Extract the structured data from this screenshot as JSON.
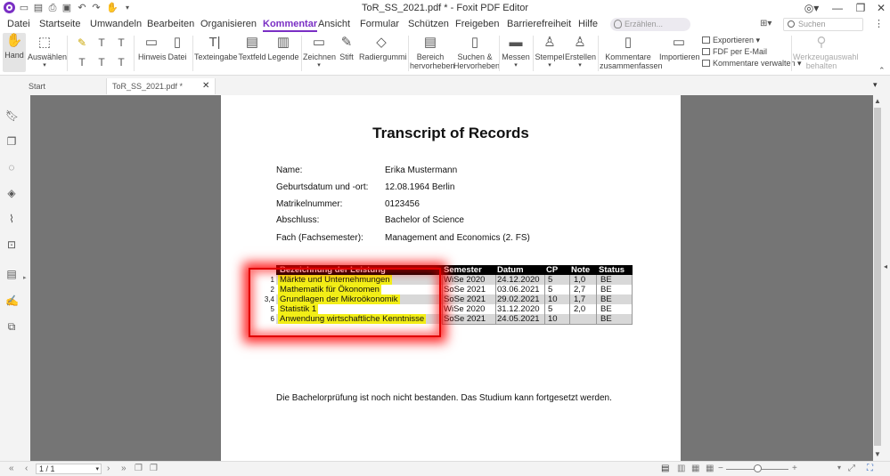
{
  "window": {
    "title": "ToR_SS_2021.pdf * - Foxit PDF Editor",
    "controls": [
      "minimize-icon",
      "restore-icon",
      "close-icon"
    ]
  },
  "menu": {
    "tabs": [
      "Datei",
      "Startseite",
      "Umwandeln",
      "Bearbeiten",
      "Organisieren",
      "Kommentar",
      "Ansicht",
      "Formular",
      "Schützen",
      "Freigeben",
      "Barrierefreiheit",
      "Hilfe"
    ],
    "active_tab": "Kommentar",
    "tell_me_placeholder": "Erzählen...",
    "search_placeholder": "Suchen"
  },
  "ribbon": {
    "hand": "Hand",
    "select": "Auswählen",
    "note": "Hinweis",
    "file": "Datei",
    "typewriter": "Texteingabe",
    "textbox": "Textfeld",
    "callout": "Legende",
    "drawing": "Zeichnen",
    "pencil": "Stift",
    "eraser": "Radiergummi",
    "area_highlight": [
      "Bereich",
      "hervorheben"
    ],
    "search_highlight": [
      "Suchen &",
      "Hervorheben"
    ],
    "measure": "Messen",
    "stamp": "Stempel",
    "create": "Erstellen",
    "summarize": [
      "Kommentare",
      "zusammenfassen"
    ],
    "import": "Importieren",
    "export": "Exportieren",
    "email": "FDF per E-Mail",
    "manage": "Kommentare verwalten",
    "keep_tool": [
      "Werkzeugauswahl",
      "behalten"
    ]
  },
  "doc_tabs": {
    "start": "Start",
    "current": "ToR_SS_2021.pdf *"
  },
  "document": {
    "title": "Transcript of Records",
    "fields": [
      {
        "label": "Name:",
        "value": "Erika Mustermann"
      },
      {
        "label": "Geburtsdatum und -ort:",
        "value": "12.08.1964 Berlin"
      },
      {
        "label": "Matrikelnummer:",
        "value": "0123456"
      },
      {
        "label": "Abschluss:",
        "value": "Bachelor of Science"
      },
      {
        "label": "Fach (Fachsemester):",
        "value": "Management and Economics (2. FS)"
      }
    ],
    "table": {
      "headers": [
        "Bezeichnung der Leistung",
        "Semester",
        "Datum",
        "CP",
        "Note",
        "Status"
      ],
      "rows": [
        {
          "num": "1",
          "name": "Märkte und Unternehmungen",
          "semester": "WiSe 2020",
          "date": "24.12.2020",
          "cp": "5",
          "note": "1,0",
          "status": "BE"
        },
        {
          "num": "2",
          "name": "Mathematik für Ökonomen",
          "semester": "SoSe 2021",
          "date": "03.06.2021",
          "cp": "5",
          "note": "2,7",
          "status": "BE"
        },
        {
          "num": "3,4",
          "name": "Grundlagen der Mikroökonomik",
          "semester": "SoSe 2021",
          "date": "29.02.2021",
          "cp": "10",
          "note": "1,7",
          "status": "BE"
        },
        {
          "num": "5",
          "name": "Statistik 1",
          "semester": "WiSe 2020",
          "date": "31.12.2020",
          "cp": "5",
          "note": "2,0",
          "status": "BE"
        },
        {
          "num": "6",
          "name": "Anwendung wirtschaftliche Kenntnisse",
          "semester": "SoSe 2021",
          "date": "24.05.2021",
          "cp": "10",
          "note": "",
          "status": "BE"
        }
      ]
    },
    "note": "Die Bachelorprüfung ist noch nicht bestanden. Das Studium kann fortgesetzt werden."
  },
  "status": {
    "page": "1 / 1",
    "zoom_fraction": 0.5
  },
  "colors": {
    "accent": "#7a2fc4",
    "highlight": "#f2ee17",
    "annotation_red": "#e00000"
  }
}
